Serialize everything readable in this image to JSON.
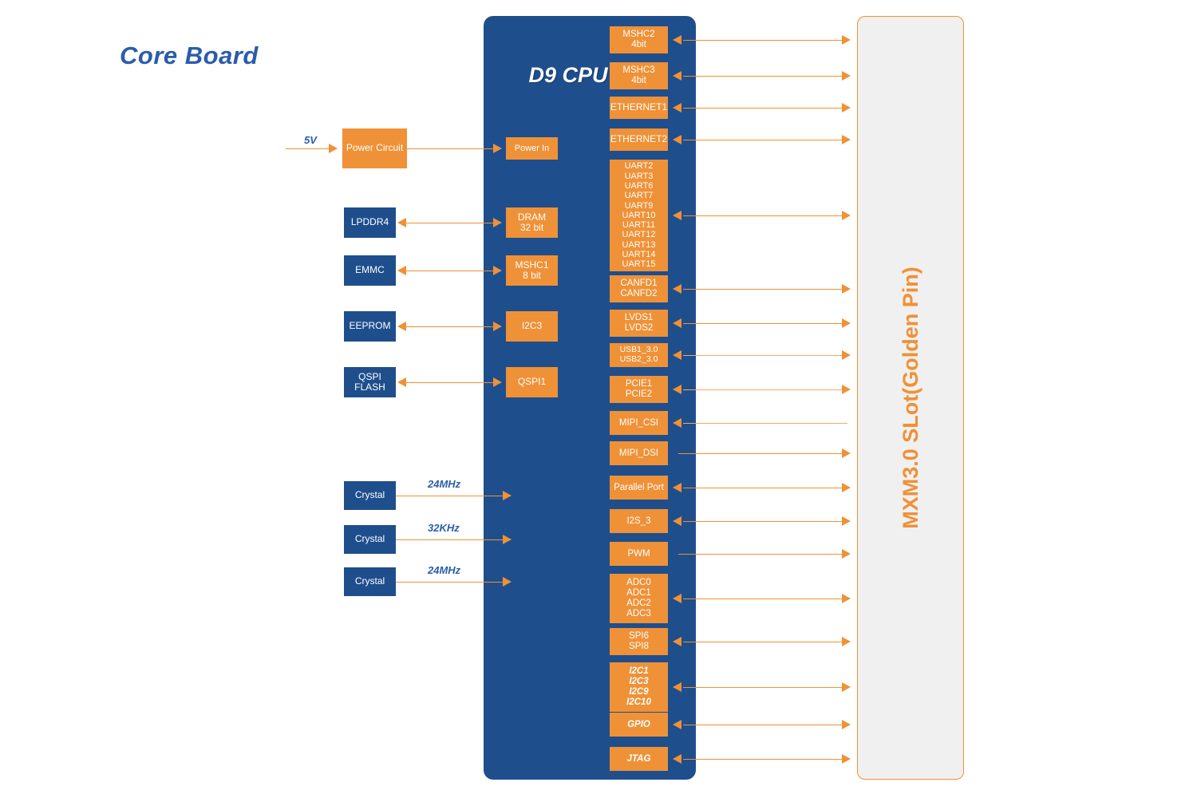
{
  "diagram": {
    "title": "Core Board",
    "cpu_panel_label": "D9 CPU",
    "mxm_panel_label": "MXM3.0 SLot(Golden Pin)",
    "colors": {
      "orange": "#ef9137",
      "blue": "#1f4e8c",
      "title_blue": "#2a5cab",
      "panel_gray": "#f0f0f0",
      "white": "#ffffff"
    }
  },
  "power": {
    "input_label": "5V",
    "circuit_label": "Power Circuit",
    "power_in_label": "Power In"
  },
  "peripherals": [
    {
      "label": "LPDDR4",
      "lines": [
        "LPDDR4"
      ]
    },
    {
      "label": "EMMC",
      "lines": [
        "EMMC"
      ]
    },
    {
      "label": "EEPROM",
      "lines": [
        "EEPROM"
      ]
    },
    {
      "label": "QSPI FLASH",
      "lines": [
        "QSPI",
        "FLASH"
      ]
    }
  ],
  "cpu_left_ports": [
    {
      "label": "DRAM 32 bit",
      "lines": [
        "DRAM",
        "32 bit"
      ]
    },
    {
      "label": "MSHC1 8 bit",
      "lines": [
        "MSHC1",
        "8 bit"
      ]
    },
    {
      "label": "I2C3",
      "lines": [
        "I2C3"
      ]
    },
    {
      "label": "QSPI1",
      "lines": [
        "QSPI1"
      ]
    }
  ],
  "crystals": [
    {
      "label": "Crystal",
      "freq": "24MHz"
    },
    {
      "label": "Crystal",
      "freq": "32KHz"
    },
    {
      "label": "Crystal",
      "freq": "24MHz"
    }
  ],
  "cpu_right_ports": [
    {
      "label": "MSHC2 4bit",
      "lines": [
        "MSHC2",
        "4bit"
      ],
      "italic": false,
      "arrow": "both"
    },
    {
      "label": "MSHC3 4bit",
      "lines": [
        "MSHC3",
        "4bit"
      ],
      "italic": false,
      "arrow": "both"
    },
    {
      "label": "ETHERNET1",
      "lines": [
        "ETHERNET1"
      ],
      "italic": false,
      "arrow": "both"
    },
    {
      "label": "ETHERNET2",
      "lines": [
        "ETHERNET2"
      ],
      "italic": false,
      "arrow": "both"
    },
    {
      "label": "UART2-UART15",
      "lines": [
        "UART2",
        "UART3",
        "UART6",
        "UART7",
        "UART9",
        "UART10",
        "UART11",
        "UART12",
        "UART13",
        "UART14",
        "UART15"
      ],
      "italic": false,
      "arrow": "both"
    },
    {
      "label": "CANFD1 CANFD2",
      "lines": [
        "CANFD1",
        "CANFD2"
      ],
      "italic": false,
      "arrow": "both"
    },
    {
      "label": "LVDS1 LVDS2",
      "lines": [
        "LVDS1",
        "LVDS2"
      ],
      "italic": false,
      "arrow": "both"
    },
    {
      "label": "USB1_3.0 USB2_3.0",
      "lines": [
        "USB1_3.0",
        "USB2_3.0"
      ],
      "italic": false,
      "arrow": "both"
    },
    {
      "label": "PCIE1 PCIE2",
      "lines": [
        "PCIE1",
        "PCIE2"
      ],
      "italic": false,
      "arrow": "both"
    },
    {
      "label": "MIPI_CSI",
      "lines": [
        "MIPI_CSI"
      ],
      "italic": false,
      "arrow": "left"
    },
    {
      "label": "MIPI_DSI",
      "lines": [
        "MIPI_DSI"
      ],
      "italic": false,
      "arrow": "right"
    },
    {
      "label": "Parallel Port",
      "lines": [
        "Parallel Port"
      ],
      "italic": false,
      "arrow": "both"
    },
    {
      "label": "I2S_3",
      "lines": [
        "I2S_3"
      ],
      "italic": false,
      "arrow": "both"
    },
    {
      "label": "PWM",
      "lines": [
        "PWM"
      ],
      "italic": false,
      "arrow": "right"
    },
    {
      "label": "ADC0-ADC3",
      "lines": [
        "ADC0",
        "ADC1",
        "ADC2",
        "ADC3"
      ],
      "italic": false,
      "arrow": "both"
    },
    {
      "label": "SPI6 SPI8",
      "lines": [
        "SPI6",
        "SPI8"
      ],
      "italic": false,
      "arrow": "both"
    },
    {
      "label": "I2C1 I2C3 I2C9 I2C10",
      "lines": [
        "I2C1",
        "I2C3",
        "I2C9",
        "I2C10"
      ],
      "italic": true,
      "arrow": "both"
    },
    {
      "label": "GPIO",
      "lines": [
        "GPIO"
      ],
      "italic": true,
      "arrow": "both"
    },
    {
      "label": "JTAG",
      "lines": [
        "JTAG"
      ],
      "italic": true,
      "arrow": "both"
    }
  ]
}
